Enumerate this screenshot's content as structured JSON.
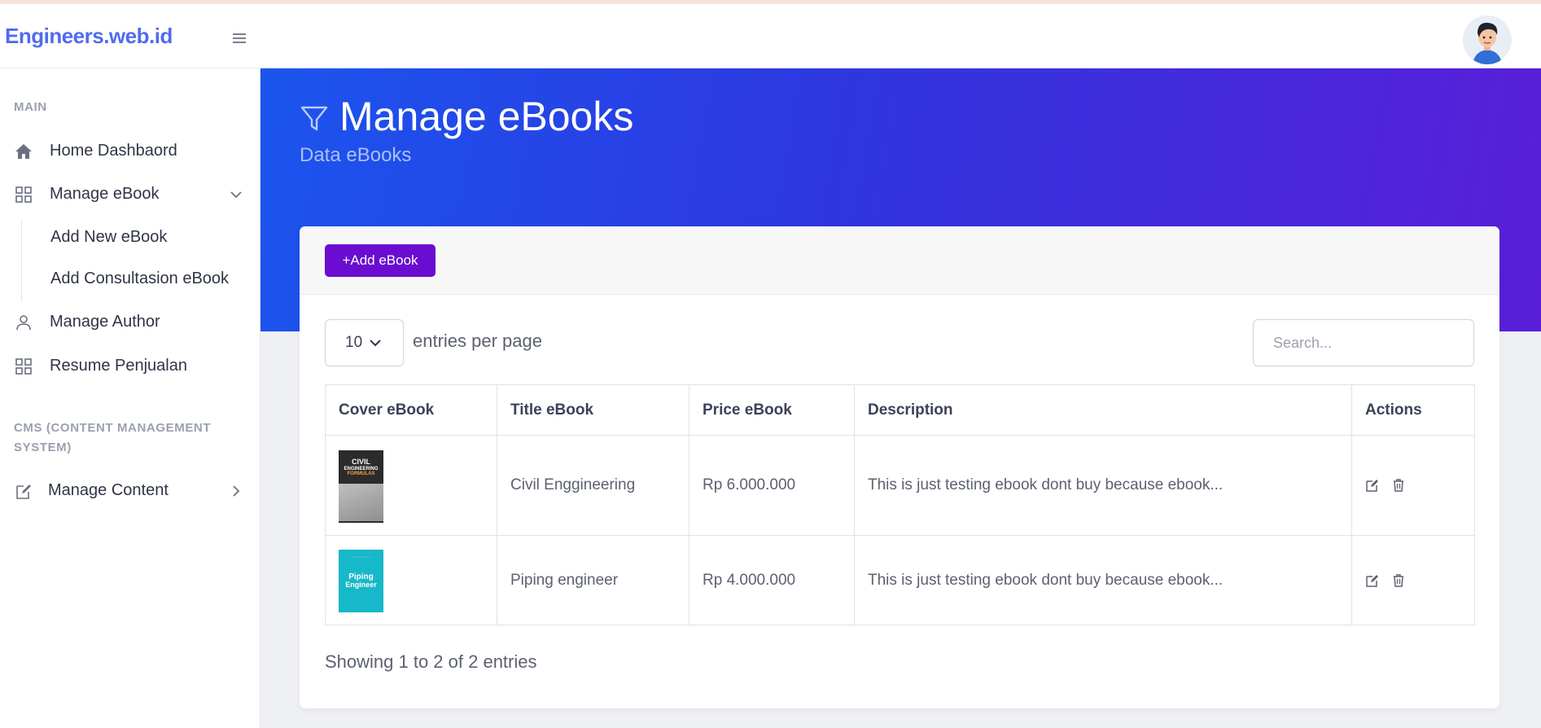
{
  "app": {
    "brand": "Engineers.web.id"
  },
  "sidebar": {
    "sections": [
      {
        "title": "MAIN"
      },
      {
        "title": "CMS (CONTENT MANAGEMENT SYSTEM)"
      }
    ],
    "items": [
      {
        "label": "Home Dashbaord",
        "icon": "home-icon"
      },
      {
        "label": "Manage eBook",
        "icon": "grid-icon"
      },
      {
        "label": "Manage Author",
        "icon": "user-icon"
      },
      {
        "label": "Resume Penjualan",
        "icon": "grid-icon"
      },
      {
        "label": "Manage Content",
        "icon": "edit-icon"
      }
    ],
    "sub_items": [
      {
        "label": "Add New eBook"
      },
      {
        "label": "Add Consultasion eBook"
      }
    ]
  },
  "hero": {
    "title": "Manage eBooks",
    "subtitle": "Data eBooks",
    "icon": "filter-icon"
  },
  "toolbar": {
    "add_label": "+Add eBook"
  },
  "table_controls": {
    "per_page_value": "10",
    "per_page_label": "entries per page",
    "search_placeholder": "Search..."
  },
  "table": {
    "columns": [
      "Cover eBook",
      "Title eBook",
      "Price eBook",
      "Description",
      "Actions"
    ],
    "rows": [
      {
        "title": "Civil Enggineering",
        "price": "Rp 6.000.000",
        "description": "This is just testing ebook dont buy because ebook...",
        "cover": {
          "line1": "CIVIL",
          "line2": "ENGINEERING",
          "line3": "FORMULAS",
          "color": "#2b2b2b"
        }
      },
      {
        "title": "Piping engineer",
        "price": "Rp 4.000.000",
        "description": "This is just testing ebook dont buy because ebook...",
        "cover": {
          "line1": "Piping",
          "line2": "Engineer",
          "line3": "",
          "color": "#16b8c9"
        }
      }
    ]
  },
  "footer": {
    "info": "Showing 1 to 2 of 2 entries"
  },
  "colors": {
    "brand": "#4f6bf0",
    "primary_button": "#6a0dd1",
    "hero_start": "#1b55ee",
    "hero_end": "#5a1ed8"
  }
}
